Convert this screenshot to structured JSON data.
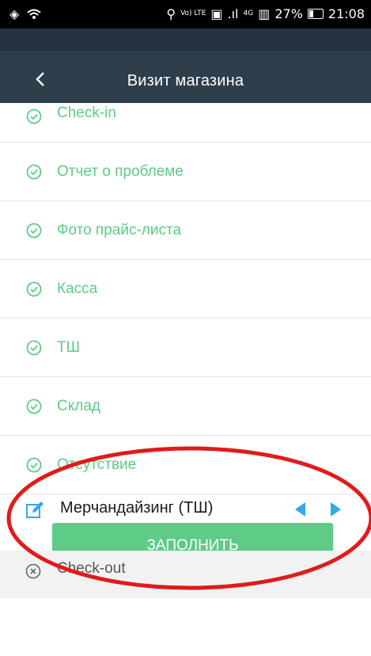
{
  "status_bar": {
    "network_label": "Vo) LTE",
    "signal_label": "4G",
    "battery_percent": "27%",
    "time": "21:08"
  },
  "header": {
    "title": "Визит магазина"
  },
  "tasks": [
    {
      "label": "Check-in",
      "status": "done"
    },
    {
      "label": "Отчет о проблеме",
      "status": "done"
    },
    {
      "label": "Фото прайс-листа",
      "status": "done"
    },
    {
      "label": "Касса",
      "status": "done"
    },
    {
      "label": "ТШ",
      "status": "done"
    },
    {
      "label": "Склад",
      "status": "done"
    },
    {
      "label": "Отсутствие",
      "status": "done"
    }
  ],
  "current_task": {
    "label": "Мерчандайзинг (ТШ)",
    "icon": "edit-icon"
  },
  "fill_button": {
    "label": "ЗАПОЛНИТЬ"
  },
  "checkout": {
    "label": "Check-out",
    "status": "pending"
  },
  "colors": {
    "accent_green": "#5ecb86",
    "header_bg": "#2e3e4a",
    "nav_arrows": "#34a8e8",
    "annotation_ellipse": "#e01b1b"
  }
}
